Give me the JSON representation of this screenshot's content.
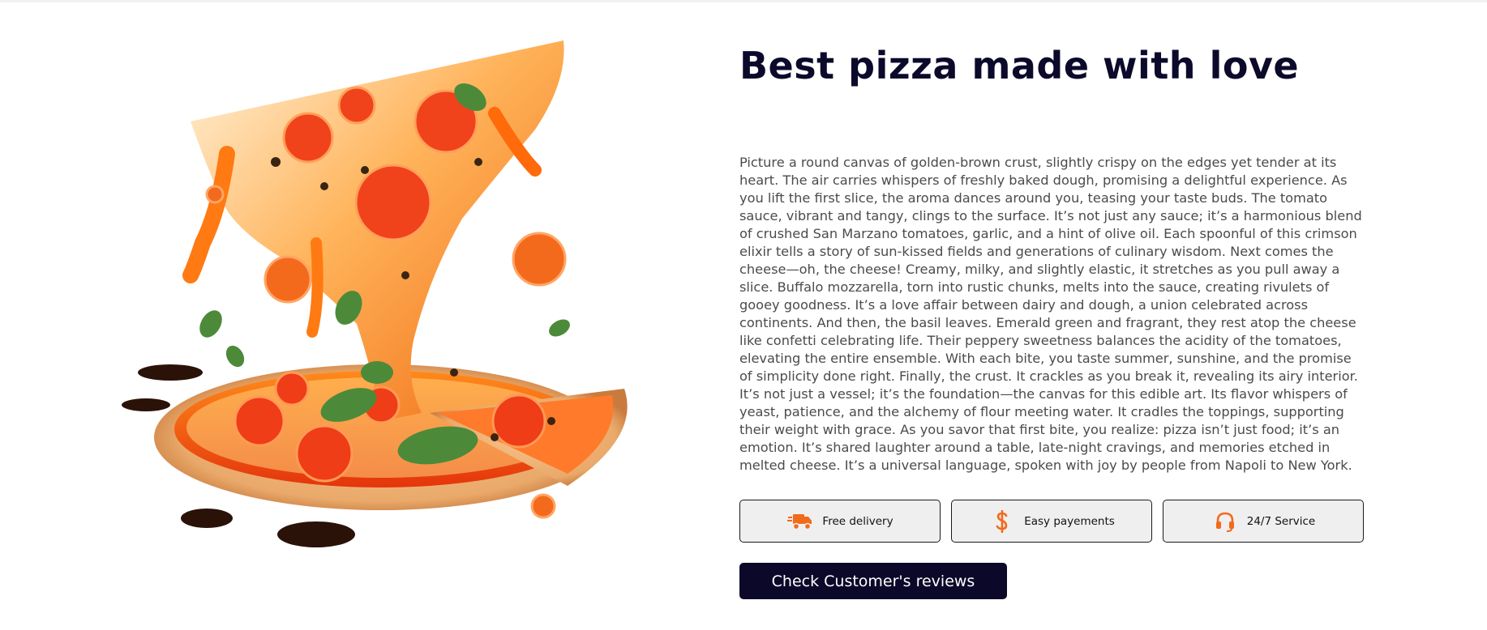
{
  "hero": {
    "title": "Best pizza made with love",
    "description": "Picture a round canvas of golden-brown crust, slightly crispy on the edges yet tender at its heart. The air carries whispers of freshly baked dough, promising a delightful experience. As you lift the first slice, the aroma dances around you, teasing your taste buds. The tomato sauce, vibrant and tangy, clings to the surface. It’s not just any sauce; it’s a harmonious blend of crushed San Marzano tomatoes, garlic, and a hint of olive oil. Each spoonful of this crimson elixir tells a story of sun-kissed fields and generations of culinary wisdom. Next comes the cheese—oh, the cheese! Creamy, milky, and slightly elastic, it stretches as you pull away a slice. Buffalo mozzarella, torn into rustic chunks, melts into the sauce, creating rivulets of gooey goodness. It’s a love affair between dairy and dough, a union celebrated across continents. And then, the basil leaves. Emerald green and fragrant, they rest atop the cheese like confetti celebrating life. Their peppery sweetness balances the acidity of the tomatoes, elevating the entire ensemble. With each bite, you taste summer, sunshine, and the promise of simplicity done right. Finally, the crust. It crackles as you break it, revealing its airy interior. It’s not just a vessel; it’s the foundation—the canvas for this edible art. Its flavor whispers of yeast, patience, and the alchemy of flour meeting water. It cradles the toppings, supporting their weight with grace. As you savor that first bite, you realize: pizza isn’t just food; it’s an emotion. It’s shared laughter around a table, late-night cravings, and memories etched in melted cheese. It’s a universal language, spoken with joy by people from Napoli to New York."
  },
  "features": [
    {
      "label": "Free delivery",
      "icon": "delivery-truck-icon"
    },
    {
      "label": "Easy payements",
      "icon": "dollar-icon"
    },
    {
      "label": "24/7 Service",
      "icon": "headset-icon"
    }
  ],
  "cta": {
    "label": "Check Customer's reviews"
  },
  "colors": {
    "accent": "#f26a1b",
    "dark": "#0b0829",
    "text": "#4b4b4b"
  }
}
